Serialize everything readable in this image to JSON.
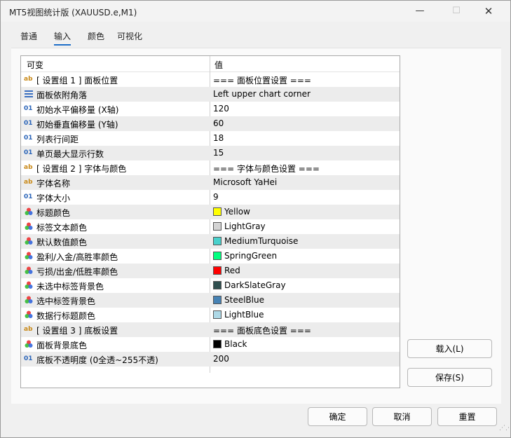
{
  "window": {
    "title": "MT5视图统计版 (XAUUSD.e,M1)",
    "minimize": "—",
    "maximize": "☐",
    "close": "✕"
  },
  "tabs": [
    {
      "label": "普通",
      "active": false
    },
    {
      "label": "输入",
      "active": true
    },
    {
      "label": "颜色",
      "active": false
    },
    {
      "label": "可视化",
      "active": false
    }
  ],
  "grid": {
    "headers": {
      "variable": "可变",
      "value": "值"
    },
    "rows": [
      {
        "icon": "ab",
        "label": "[ 设置组 1 ] 面板位置",
        "value": "=== 面板位置设置 ==="
      },
      {
        "icon": "list",
        "label": "面板依附角落",
        "value": "Left upper chart corner"
      },
      {
        "icon": "01",
        "label": "初始水平偏移量 (X轴)",
        "value": "120"
      },
      {
        "icon": "01",
        "label": "初始垂直偏移量 (Y轴)",
        "value": "60"
      },
      {
        "icon": "01",
        "label": "列表行间距",
        "value": "18"
      },
      {
        "icon": "01",
        "label": "单页最大显示行数",
        "value": "15"
      },
      {
        "icon": "ab",
        "label": "[ 设置组 2 ] 字体与颜色",
        "value": "=== 字体与颜色设置 ==="
      },
      {
        "icon": "ab",
        "label": "字体名称",
        "value": "Microsoft YaHei"
      },
      {
        "icon": "01",
        "label": "字体大小",
        "value": "9"
      },
      {
        "icon": "color",
        "label": "标题颜色",
        "value": "Yellow",
        "swatch": "#ffff00"
      },
      {
        "icon": "color",
        "label": "标签文本颜色",
        "value": "LightGray",
        "swatch": "#d3d3d3"
      },
      {
        "icon": "color",
        "label": "默认数值颜色",
        "value": "MediumTurquoise",
        "swatch": "#48d1cc"
      },
      {
        "icon": "color",
        "label": "盈利/入金/高胜率颜色",
        "value": "SpringGreen",
        "swatch": "#00ff7f"
      },
      {
        "icon": "color",
        "label": "亏损/出金/低胜率颜色",
        "value": "Red",
        "swatch": "#ff0000"
      },
      {
        "icon": "color",
        "label": "未选中标签背景色",
        "value": "DarkSlateGray",
        "swatch": "#2f4f4f"
      },
      {
        "icon": "color",
        "label": "选中标签背景色",
        "value": "SteelBlue",
        "swatch": "#4682b4"
      },
      {
        "icon": "color",
        "label": "数据行标题颜色",
        "value": "LightBlue",
        "swatch": "#add8e6"
      },
      {
        "icon": "ab",
        "label": "[ 设置组 3 ] 底板设置",
        "value": "=== 面板底色设置 ==="
      },
      {
        "icon": "color",
        "label": "面板背景底色",
        "value": "Black",
        "swatch": "#000000"
      },
      {
        "icon": "01",
        "label": "底板不透明度 (0全透~255不透)",
        "value": "200"
      }
    ]
  },
  "buttons": {
    "load": "载入(L)",
    "save": "保存(S)",
    "ok": "确定",
    "cancel": "取消",
    "reset": "重置"
  }
}
